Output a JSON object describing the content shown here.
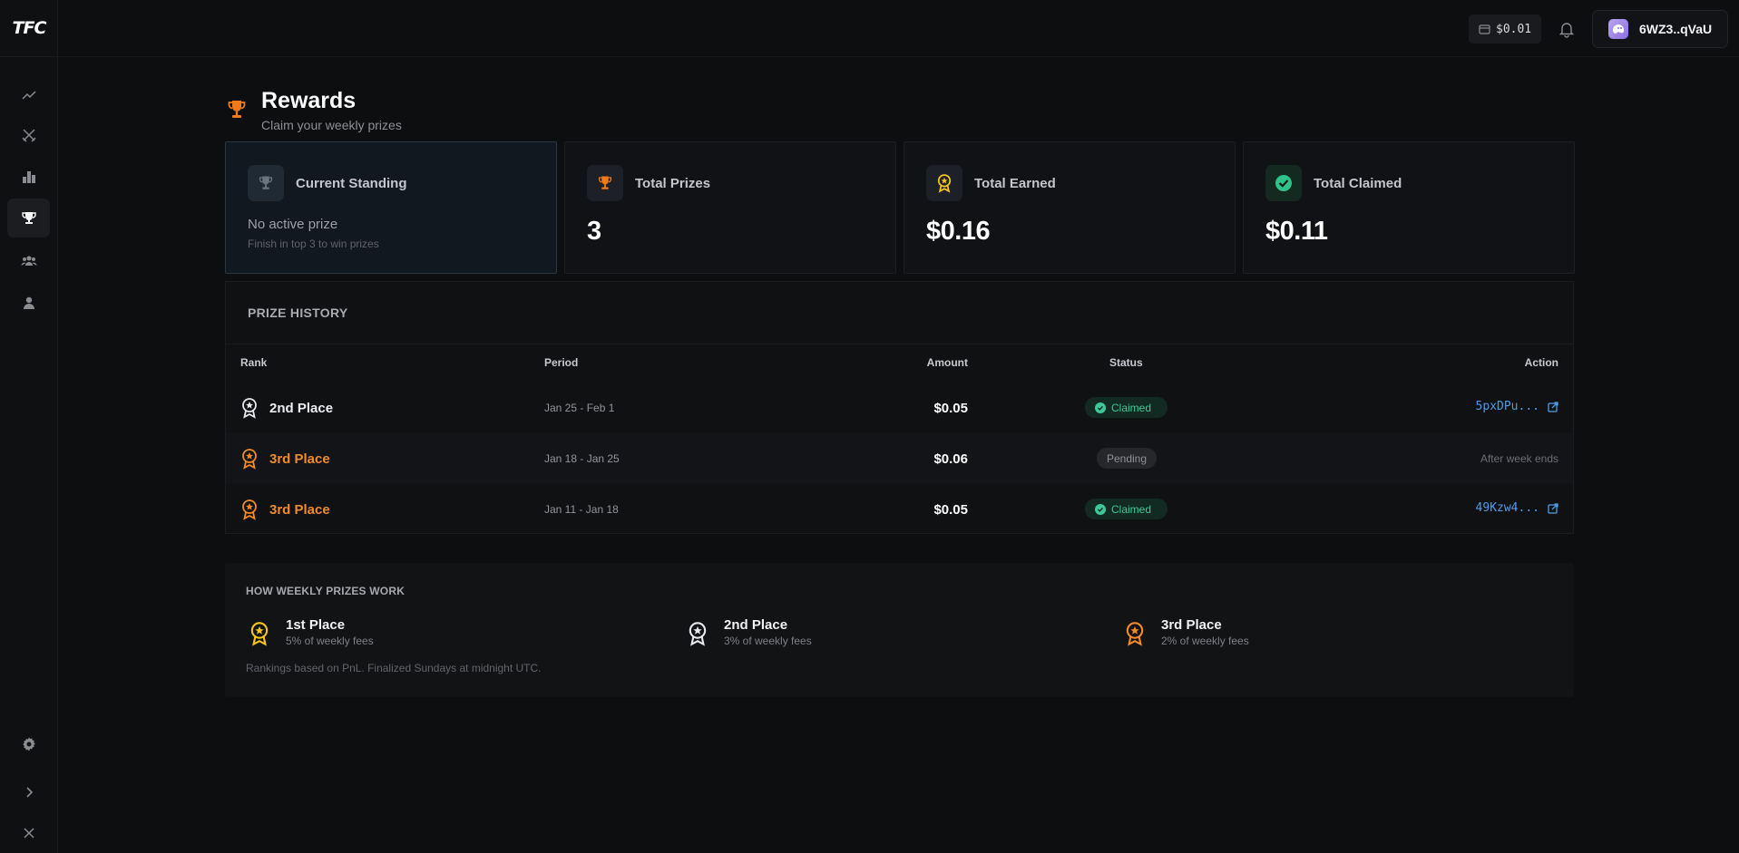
{
  "app": {
    "logo": "TFC"
  },
  "sidebar": {
    "items": [
      {
        "name": "trading",
        "icon": "trend-line-icon"
      },
      {
        "name": "battles",
        "icon": "crossed-swords-icon"
      },
      {
        "name": "leaderboard",
        "icon": "bar-chart-icon"
      },
      {
        "name": "rewards",
        "icon": "trophy-icon",
        "active": true
      },
      {
        "name": "community",
        "icon": "group-icon"
      },
      {
        "name": "profile",
        "icon": "user-icon"
      }
    ],
    "bottom": [
      "gear-icon",
      "chevron-right-icon",
      "close-icon"
    ]
  },
  "topbar": {
    "balance": "$0.01",
    "wallet": "6WZ3..qVaU"
  },
  "header": {
    "title": "Rewards",
    "subtitle": "Claim your weekly prizes"
  },
  "cards": {
    "standing": {
      "label": "Current Standing",
      "main": "No active prize",
      "sub": "Finish in top 3 to win prizes"
    },
    "total_prizes": {
      "label": "Total Prizes",
      "value": "3"
    },
    "total_earned": {
      "label": "Total Earned",
      "value": "$0.16"
    },
    "total_claimed": {
      "label": "Total Claimed",
      "value": "$0.11"
    }
  },
  "history": {
    "title": "PRIZE HISTORY",
    "columns": {
      "rank": "Rank",
      "period": "Period",
      "amount": "Amount",
      "status": "Status",
      "action": "Action"
    },
    "rows": [
      {
        "rank": "2nd Place",
        "period": "Jan 25 - Feb 1",
        "amount": "$0.05",
        "status": "Claimed",
        "action": "5pxDPu..."
      },
      {
        "rank": "3rd Place",
        "period": "Jan 18 - Jan 25",
        "amount": "$0.06",
        "status": "Pending",
        "action": "After week ends"
      },
      {
        "rank": "3rd Place",
        "period": "Jan 11 - Jan 18",
        "amount": "$0.05",
        "status": "Claimed",
        "action": "49Kzw4..."
      }
    ]
  },
  "how": {
    "title": "HOW WEEKLY PRIZES WORK",
    "items": [
      {
        "place": "1st Place",
        "desc": "5% of weekly fees"
      },
      {
        "place": "2nd Place",
        "desc": "3% of weekly fees"
      },
      {
        "place": "3rd Place",
        "desc": "2% of weekly fees"
      }
    ],
    "footnote": "Rankings based on PnL. Finalized Sundays at midnight UTC."
  },
  "colors": {
    "gold": "#f5c518",
    "silver": "#e6e8ec",
    "bronze": "#f08b2a",
    "claimed": "#3ec79a",
    "link": "#4e9de8"
  }
}
